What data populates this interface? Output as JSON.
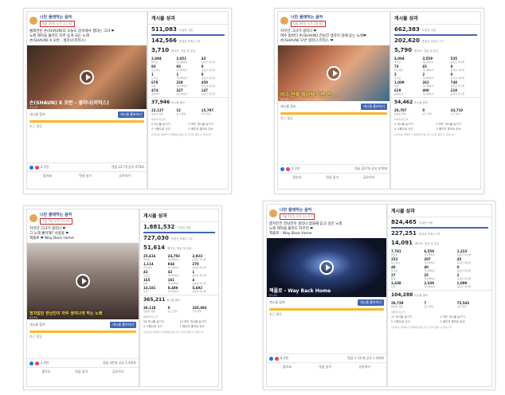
{
  "page_name": "너만 몰래하는 음악",
  "screens": [
    {
      "date": "6월 26일 오후 11:43",
      "caption_lines": [
        "몰래한잔 손(SHAUN)의 오늘도 꿈속에서 썸타는 그녀 ❤",
        "노래 제목을 몰라도 자주 듣게 되는 노래",
        "손(SHAUN) X 오반 - 생각나(리믹스)"
      ],
      "video_title": "손(SHAUN) X 오반 - 생각나(리믹스)",
      "video_time": "01:23",
      "boost_text": "게시물 참여 ",
      "boost_button": "게시물 홍보하기",
      "reach_note": "최근 활동",
      "reactions": "2.1천",
      "comments": "댓글 227개  공유 470회",
      "actions": [
        "좋아요",
        "댓글 달기",
        "공유하기"
      ],
      "insights_title": "게시물 성과",
      "metric1": {
        "value": "511,083",
        "label": "도달한 사람"
      },
      "metric2": {
        "value": "142,566",
        "label": "동영상 조회수 3초"
      },
      "metric3": {
        "value": "3,710",
        "label": "좋아요, 댓글 및 공유"
      },
      "grid": [
        [
          "2,094",
          "좋아요"
        ],
        [
          "2,051",
          "게시물에서"
        ],
        [
          "43",
          "공유한 게시물"
        ],
        [
          "93",
          "최고예요"
        ],
        [
          "93",
          "게시물에서"
        ],
        [
          "0",
          "공유한 게시물"
        ],
        [
          "1",
          "웃겨요"
        ],
        [
          "1",
          "게시물에서"
        ],
        [
          "0",
          "공유한 게시물"
        ],
        [
          "678",
          "댓글"
        ],
        [
          "228",
          "게시물에서"
        ],
        [
          "450",
          "공유한 게시물"
        ],
        [
          "474",
          "공유하기"
        ],
        [
          "327",
          "게시물에서"
        ],
        [
          "147",
          "공유한 게시물"
        ]
      ],
      "total": {
        "value": "37,946",
        "label": "게시물 클릭"
      },
      "clicks": [
        [
          "22,137",
          "동영상 재생"
        ],
        [
          "12",
          "링크 클릭"
        ],
        [
          "15,797",
          "기타 클릭"
        ]
      ],
      "neg_title": "부정적 피드백",
      "neg": [
        "0 게시물 숨기기",
        "0 모든 게시물 숨기기",
        "0 스팸으로 신고",
        "0 페이지 좋아요 취소"
      ],
      "foot": "인사이트 데이터가 업데이트되는 데 시간이 걸릴 수 있습니다"
    },
    {
      "date": "6월 26일 오후 10:05",
      "caption_lines": [
        "자꾸만 그녀가 생각나 ❤",
        "여수 밤바다 손(SHAUN) 전남친 생각이 날때 듣는 노래❤",
        "손(SHAUN) 오반 생각나 리믹스 ❤"
      ],
      "video_title": "여수 전화 에이랑 오반 손 ...",
      "video_time": "00:31",
      "boost_text": "게시물 참여 ",
      "boost_button": "게시물 홍보하기",
      "reach_note": "최근 활동",
      "reactions": "2.1천",
      "comments": "댓글 227개  공유 470회",
      "actions": [
        "좋아요",
        "댓글 달기",
        "공유하기"
      ],
      "insights_title": "게시물 성과",
      "metric1": {
        "value": "662,383",
        "label": "도달한 사람"
      },
      "metric2": {
        "value": "202,620",
        "label": "동영상 조회수 3초"
      },
      "metric3": {
        "value": "5,790",
        "label": "좋아요, 댓글 및 공유"
      },
      "grid": [
        [
          "4,094",
          "좋아요"
        ],
        [
          "3,559",
          "게시물에서"
        ],
        [
          "535",
          "공유한 게시물"
        ],
        [
          "73",
          "최고예요"
        ],
        [
          "65",
          "게시물에서"
        ],
        [
          "8",
          "공유한 게시물"
        ],
        [
          "2",
          "웃겨요"
        ],
        [
          "2",
          "게시물에서"
        ],
        [
          "0",
          "공유한 게시물"
        ],
        [
          "1,009",
          "댓글"
        ],
        [
          "261",
          "게시물에서"
        ],
        [
          "748",
          "공유한 게시물"
        ],
        [
          "619",
          "공유하기"
        ],
        [
          "400",
          "게시물에서"
        ],
        [
          "219",
          "공유한 게시물"
        ]
      ],
      "total": {
        "value": "54,462",
        "label": "게시물 클릭"
      },
      "clicks": [
        [
          "20,797",
          "동영상 재생"
        ],
        [
          "0",
          "링크 클릭"
        ],
        [
          "33,710",
          "기타 클릭"
        ]
      ],
      "neg_title": "부정적 피드백",
      "neg": [
        "0 게시물 숨기기",
        "0 모든 게시물 숨기기",
        "0 스팸으로 신고",
        "0 페이지 좋아요 취소"
      ],
      "foot": "인사이트 데이터가 업데이트되는 데 시간이 걸릴 수 있습니다"
    },
    {
      "date": "7월 5일 오후 11:41",
      "caption_lines": [
        "자꾸만 그녀가 생각나 ❤",
        "그 노래 좋아해? 사랑을 ❤",
        "잭플로 ❤ Way Back Home"
      ],
      "video_title": "정차없던 한남친이 자주 생각나게 하는 노래",
      "video_time": "01:51",
      "boost_text": "게시물 참여 ",
      "boost_button": "게시물 홍보하기",
      "reach_note": "최근 활동",
      "reactions": "2.4천",
      "comments": "댓글 3천개  공유 1.4천회",
      "actions": [
        "좋아요",
        "댓글 달기",
        "공유하기"
      ],
      "insights_title": "게시물 성과",
      "metric1": {
        "value": "1,881,532",
        "label": "도달한 사람"
      },
      "metric2": {
        "value": "727,030",
        "label": "동영상 조회수 3초"
      },
      "metric3": {
        "value": "51,614",
        "label": "좋아요, 댓글 및 공유"
      },
      "grid": [
        [
          "25,616",
          "좋아요"
        ],
        [
          "24,792",
          "게시물에서"
        ],
        [
          "2,923",
          "공유한 게시물"
        ],
        [
          "1,114",
          "최고예요"
        ],
        [
          "844",
          "게시물에서"
        ],
        [
          "270",
          "공유한 게시물"
        ],
        [
          "43",
          "웃겨요"
        ],
        [
          "42",
          "게시물에서"
        ],
        [
          "1",
          "공유한 게시물"
        ],
        [
          "165",
          "와우"
        ],
        [
          "161",
          "게시물에서"
        ],
        [
          "4",
          "공유한 게시물"
        ],
        [
          "14,181",
          "댓글"
        ],
        [
          "8,489",
          "게시물에서"
        ],
        [
          "5,692",
          "공유한 게시물"
        ]
      ],
      "total": {
        "value": "365,211",
        "label": "게시물 클릭"
      },
      "clicks": [
        [
          "30,118",
          "동영상 재생"
        ],
        [
          "0",
          "링크 클릭"
        ],
        [
          "335,093",
          "기타 클릭"
        ]
      ],
      "neg_title": "부정적 피드백",
      "neg": [
        "58 게시물 숨기기",
        "10 모든 게시물 숨기기",
        "0 스팸으로 신고",
        "1 페이지 좋아요 취소"
      ],
      "foot": "인사이트 데이터가 업데이트되는 데 시간이 걸릴 수 있습니다"
    },
    {
      "date": "7월 16일 오후 11:47",
      "caption_lines": [
        "룸치킨은 전남친이 생각나 없을때 듣고 싶은 노래",
        "노래 제목을 몰라도 자꾸만 ❤",
        "잭플로 - Way Back Home"
      ],
      "video_title": "잭플로 - Way Back Home",
      "video_time": "01:41",
      "boost_text": "게시물 참여 ",
      "boost_button": "게시물 홍보하기",
      "reach_note": "최근 활동",
      "reactions": "8.2천",
      "comments": "댓글 1.1만개  공유 1.4천회",
      "actions": [
        "좋아요",
        "댓글 달기",
        "공유하기"
      ],
      "insights_title": "게시물 성과",
      "metric1": {
        "value": "824,465",
        "label": "도달한 사람"
      },
      "metric2": {
        "value": "227,251",
        "label": "동영상 조회수 3초"
      },
      "metric3": {
        "value": "14,091",
        "label": "좋아요, 댓글 및 공유"
      },
      "grid": [
        [
          "7,781",
          "좋아요"
        ],
        [
          "6,558",
          "게시물에서"
        ],
        [
          "1,223",
          "공유한 게시물"
        ],
        [
          "252",
          "최고예요"
        ],
        [
          "207",
          "게시물에서"
        ],
        [
          "45",
          "공유한 게시물"
        ],
        [
          "40",
          "웃겨요"
        ],
        [
          "40",
          "게시물에서"
        ],
        [
          "0",
          "공유한 게시물"
        ],
        [
          "27",
          "와우"
        ],
        [
          "25",
          "게시물에서"
        ],
        [
          "2",
          "공유한 게시물"
        ],
        [
          "3,438",
          "댓글"
        ],
        [
          "2,339",
          "게시물에서"
        ],
        [
          "1,099",
          "공유한 게시물"
        ]
      ],
      "total": {
        "value": "104,288",
        "label": "게시물 클릭"
      },
      "clicks": [
        [
          "28,738",
          "동영상 재생"
        ],
        [
          "7",
          "링크 클릭"
        ],
        [
          "75,543",
          "기타 클릭"
        ]
      ],
      "neg_title": "부정적 피드백",
      "neg": [
        "13 게시물 숨기기",
        "1 모든 게시물 숨기기",
        "0 스팸으로 신고",
        "0 페이지 좋아요 취소"
      ],
      "foot": "인사이트 데이터가 업데이트되는 데 시간이 걸릴 수 있습니다"
    }
  ]
}
